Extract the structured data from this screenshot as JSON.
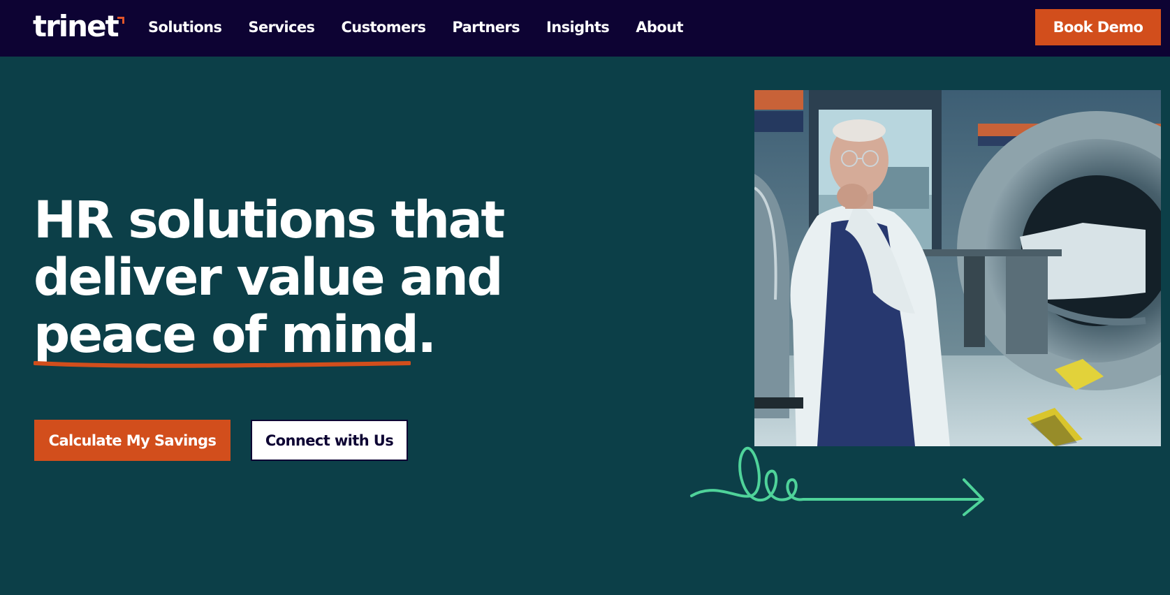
{
  "nav": {
    "logo_text": "trinet",
    "links": [
      "Solutions",
      "Services",
      "Customers",
      "Partners",
      "Insights",
      "About"
    ],
    "cta_label": "Book Demo"
  },
  "hero": {
    "title_lines": [
      "HR solutions that",
      "deliver value and",
      "peace of mind."
    ],
    "primary_button": "Calculate My Savings",
    "secondary_button": "Connect with Us"
  },
  "colors": {
    "nav_bg": "#0d0333",
    "hero_bg": "#0c3f48",
    "accent_orange": "#d24e1c",
    "squiggle_green": "#4fd39a"
  }
}
